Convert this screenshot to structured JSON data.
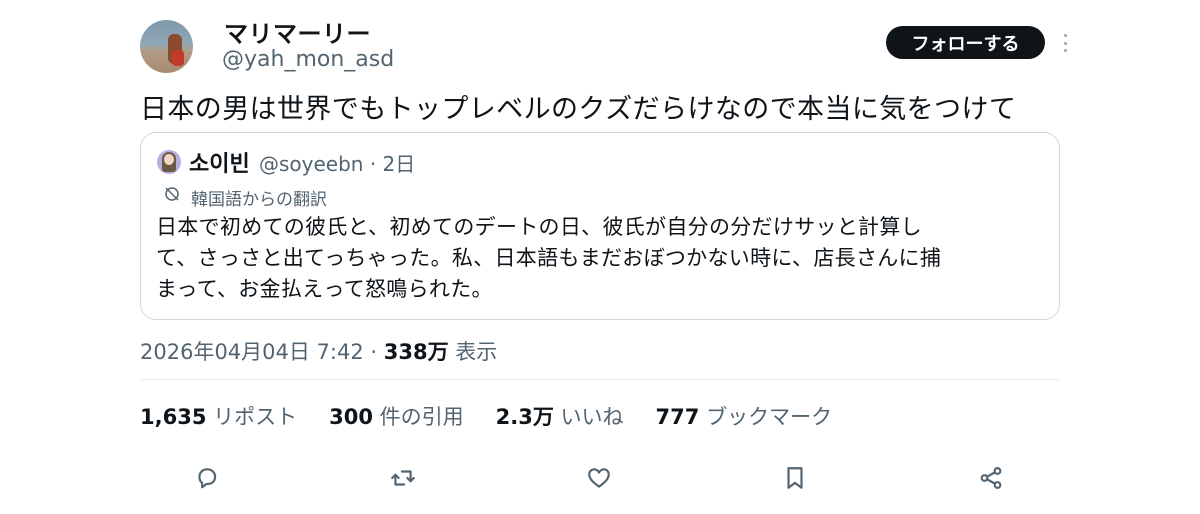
{
  "author": {
    "display_name": "マリマーリー",
    "handle": "@yah_mon_asd"
  },
  "follow_label": "フォローする",
  "tweet_text": "日本の男は世界でもトップレベルのクズだらけなので本当に気をつけて",
  "quote": {
    "display_name": "소이빈",
    "handle_time": "@soyeebn · 2日",
    "translation_label": "韓国語からの翻訳",
    "lines": [
      "日本で初めての彼氏と、初めてのデートの日、彼氏が自分の分だけサッと計算し",
      "て、さっさと出てっちゃった。私、日本語もまだおぼつかない時に、店長さんに捕",
      "まって、お金払えって怒鳴られた。"
    ]
  },
  "meta": {
    "timestamp": "2026年04月04日 7:42",
    "separator": " · ",
    "views_count": "338万",
    "views_label": " 表示"
  },
  "stats": [
    {
      "num": "1,635",
      "label": " リポスト"
    },
    {
      "num": "300",
      "label": " 件の引用"
    },
    {
      "num": "2.3万",
      "label": " いいね"
    },
    {
      "num": "777",
      "label": " ブックマーク"
    }
  ],
  "icons": [
    "reply-icon",
    "repost-icon",
    "like-icon",
    "bookmark-icon",
    "share-icon",
    "more-icon",
    "translate-icon"
  ],
  "colors": {
    "text": "#0f1419",
    "secondary": "#536471",
    "border": "#cfd9de",
    "follow_bg": "#0f1419"
  }
}
